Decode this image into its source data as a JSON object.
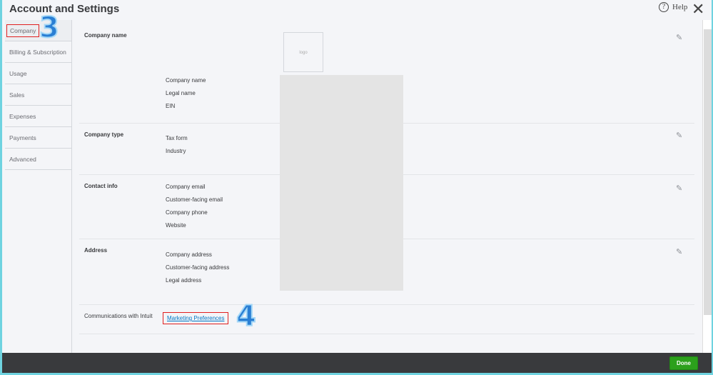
{
  "header": {
    "title": "Account and Settings",
    "help_label": "Help",
    "help_icon": "?",
    "close_icon": "✕"
  },
  "sidebar": {
    "items": [
      {
        "label": "Company"
      },
      {
        "label": "Billing & Subscription"
      },
      {
        "label": "Usage"
      },
      {
        "label": "Sales"
      },
      {
        "label": "Expenses"
      },
      {
        "label": "Payments"
      },
      {
        "label": "Advanced"
      }
    ]
  },
  "annotations": {
    "step3": "3",
    "step4": "4"
  },
  "sections": {
    "company_name": {
      "label": "Company name",
      "logo": "logo",
      "fields": [
        "Company name",
        "Legal name",
        "EIN"
      ]
    },
    "company_type": {
      "label": "Company type",
      "fields": [
        "Tax form",
        "Industry"
      ]
    },
    "contact_info": {
      "label": "Contact info",
      "fields": [
        "Company email",
        "Customer-facing email",
        "Company phone",
        "Website"
      ]
    },
    "address": {
      "label": "Address",
      "fields": [
        "Company address",
        "Customer-facing address",
        "Legal address"
      ]
    },
    "communications": {
      "label": "Communications with Intuit",
      "link": "Marketing Preferences"
    }
  },
  "footer": {
    "done_label": "Done"
  }
}
